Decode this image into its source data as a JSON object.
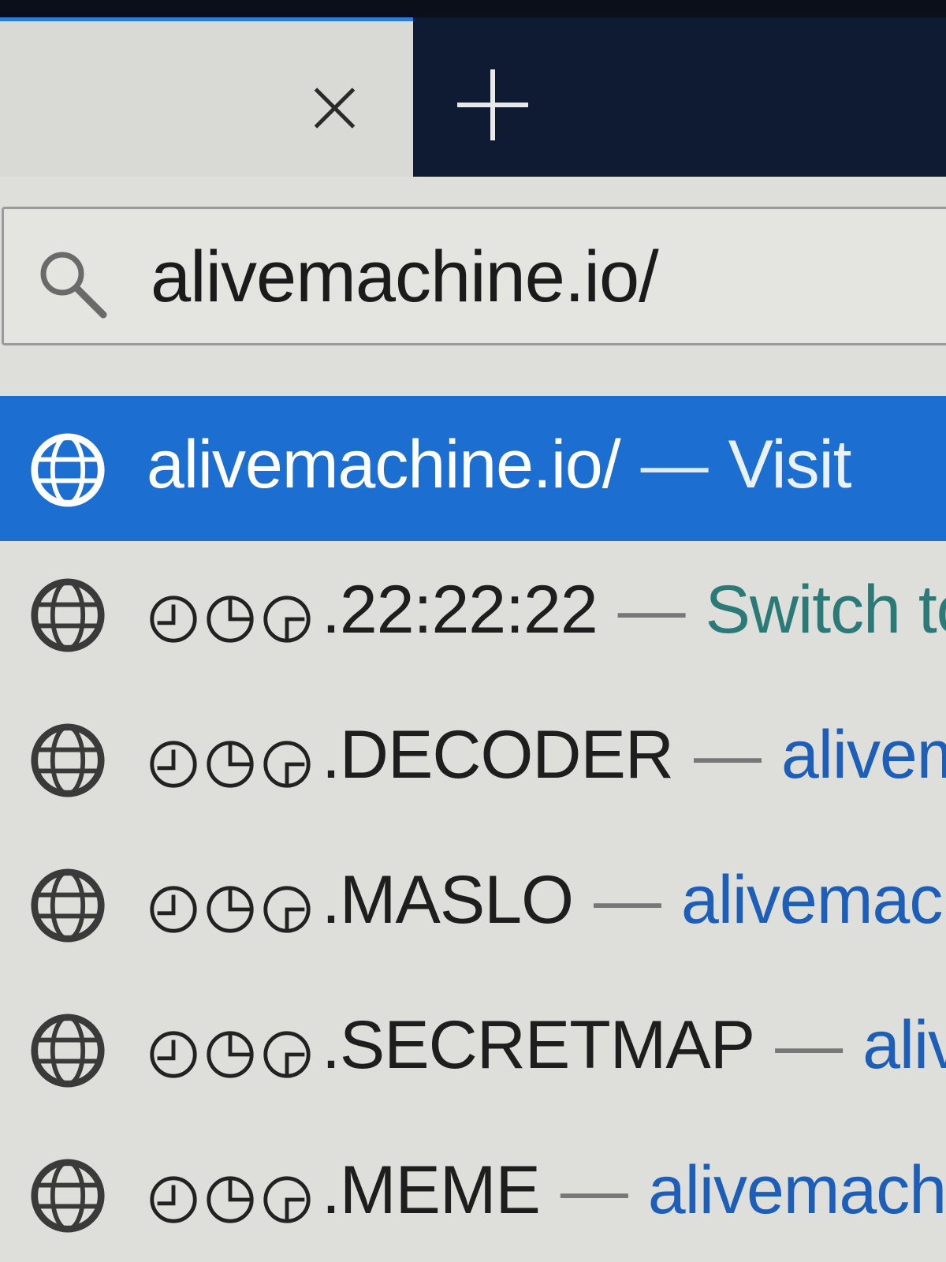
{
  "tabs": {
    "close_label": "",
    "new_tab_label": ""
  },
  "urlbar": {
    "value": "alivemachine.io/"
  },
  "colors": {
    "accent": "#1c6fd0",
    "tab_bar": "#0f1a33",
    "link": "#1d5fb8",
    "switch_tab": "#2b7a78"
  },
  "suggestions": [
    {
      "title": "alivemachine.io/",
      "separator": "—",
      "action": "Visit",
      "icon": "globe-icon",
      "selected": true
    },
    {
      "title": ".22:22:22",
      "separator": "—",
      "action": "Switch to",
      "icon": "globe-icon",
      "selected": false
    },
    {
      "title": ".DECODER",
      "separator": "—",
      "action": "alivema",
      "icon": "globe-icon",
      "selected": false
    },
    {
      "title": ".MASLO",
      "separator": "—",
      "action": "alivemach",
      "icon": "globe-icon",
      "selected": false
    },
    {
      "title": ".SECRETMAP",
      "separator": "—",
      "action": "alive",
      "icon": "globe-icon",
      "selected": false
    },
    {
      "title": ".MEME",
      "separator": "—",
      "action": "alivemachir",
      "icon": "globe-icon",
      "selected": false
    }
  ]
}
